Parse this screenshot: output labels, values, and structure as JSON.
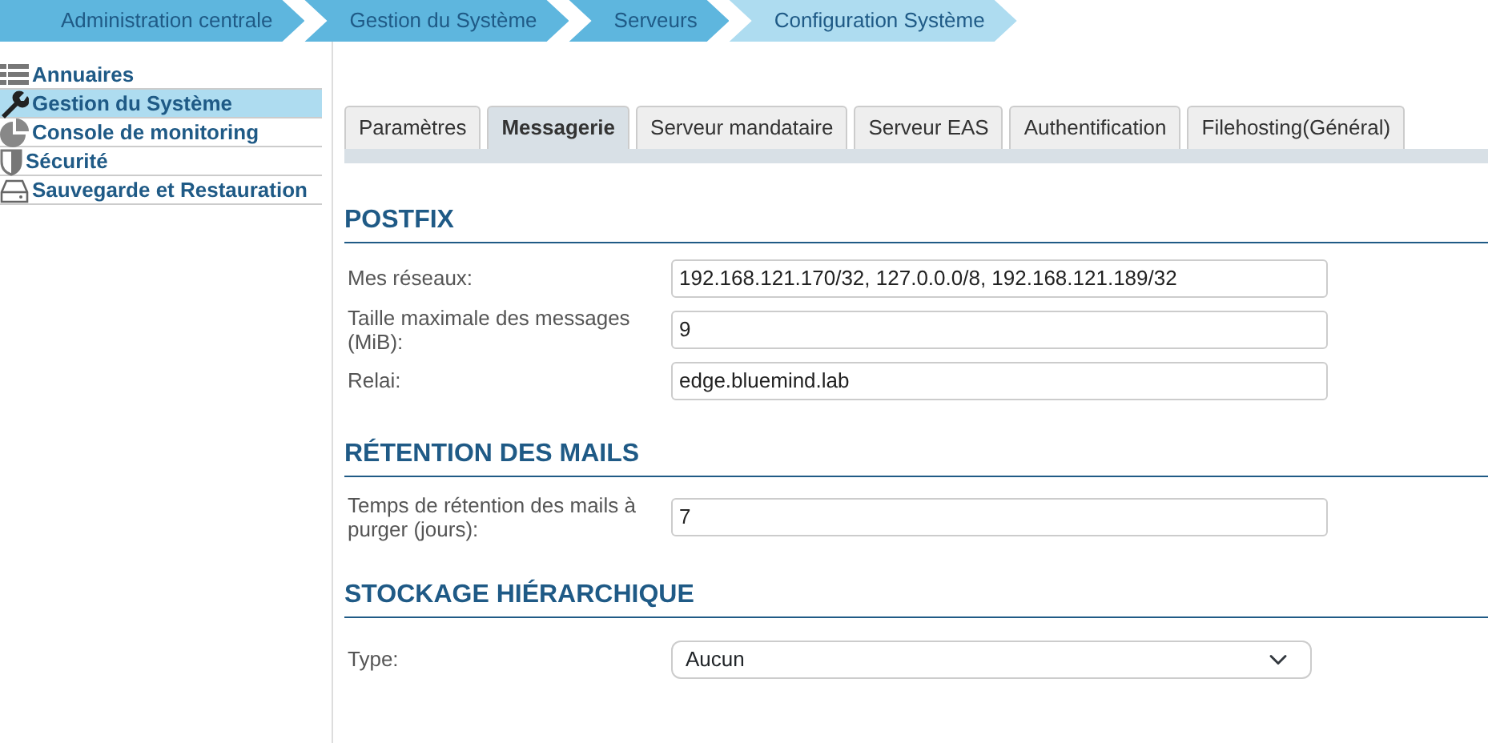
{
  "breadcrumb": [
    {
      "label": "Administration centrale",
      "selected": false
    },
    {
      "label": "Gestion du Système",
      "selected": false
    },
    {
      "label": "Serveurs",
      "selected": false
    },
    {
      "label": "Configuration Système",
      "selected": true
    }
  ],
  "sidebar": {
    "items": [
      {
        "label": "Annuaires",
        "selected": false
      },
      {
        "label": "Gestion du Système",
        "selected": true
      },
      {
        "label": "Console de monitoring",
        "selected": false
      },
      {
        "label": "Sécurité",
        "selected": false
      },
      {
        "label": "Sauvegarde et Restauration",
        "selected": false
      }
    ]
  },
  "tabs": [
    {
      "label": "Paramètres",
      "selected": false
    },
    {
      "label": "Messagerie",
      "selected": true
    },
    {
      "label": "Serveur mandataire",
      "selected": false
    },
    {
      "label": "Serveur EAS",
      "selected": false
    },
    {
      "label": "Authentification",
      "selected": false
    },
    {
      "label": "Filehosting(Général)",
      "selected": false
    }
  ],
  "sections": [
    {
      "title": "POSTFIX",
      "fields": [
        {
          "kind": "text",
          "label": "Mes réseaux:",
          "value": "192.168.121.170/32, 127.0.0.0/8, 192.168.121.189/32"
        },
        {
          "kind": "text",
          "label": "Taille maximale des messages (MiB):",
          "value": "9"
        },
        {
          "kind": "text",
          "label": "Relai:",
          "value": "edge.bluemind.lab"
        }
      ]
    },
    {
      "title": "RÉTENTION DES MAILS",
      "fields": [
        {
          "kind": "text",
          "label": "Temps de rétention des mails à purger (jours):",
          "value": "7"
        }
      ]
    },
    {
      "title": "STOCKAGE HIÉRARCHIQUE",
      "fields": [
        {
          "kind": "select",
          "label": "Type:",
          "value": "Aucun"
        }
      ]
    }
  ]
}
